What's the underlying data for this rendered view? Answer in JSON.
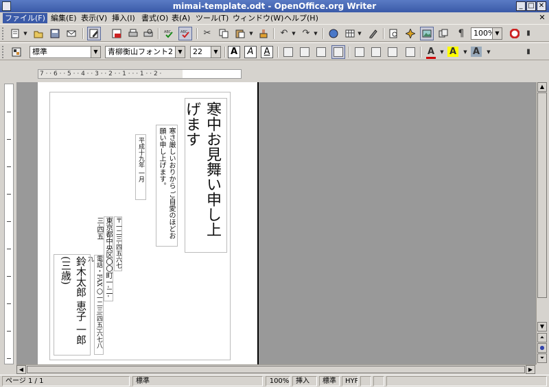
{
  "window": {
    "title": "mimai-template.odt - OpenOffice.org Writer",
    "buttons": {
      "minimize": "_",
      "maximize": "□",
      "close": "✕"
    }
  },
  "menu": [
    {
      "label": "ファイル(F)",
      "active": true
    },
    {
      "label": "編集(E)"
    },
    {
      "label": "表示(V)"
    },
    {
      "label": "挿入(I)"
    },
    {
      "label": "書式(O)"
    },
    {
      "label": "表(A)"
    },
    {
      "label": "ツール(T)"
    },
    {
      "label": "ウィンドウ(W)"
    },
    {
      "label": "ヘルプ(H)"
    }
  ],
  "toolbar": {
    "zoom": "100%",
    "paragraph_style": "標準",
    "font_name": "青柳衡山フォント2",
    "font_size": "22"
  },
  "ruler": {
    "marks": "7 · · 6 · · 5 · · 4 · · 3 · · 2 · · 1 · · · 1 · · 2 ·"
  },
  "document": {
    "greeting": "寒中お見舞い申し上げます",
    "body": "寒さ厳しいおりから ご自愛のほどお願い申し上げます。",
    "date": "平成十九年 一月",
    "postal": "〒一二三-四五六七",
    "address": "東京都中央区〇〇町一-二-三-四五",
    "phone": "電話・FAX 〇一二三(四五)六七八九",
    "names": "鈴木太郎 恵子 一郎(三歳)"
  },
  "status": {
    "page": "ページ 1 / 1",
    "style": "標準",
    "zoom": "100%",
    "insert_mode": "挿入",
    "selection_mode": "標準",
    "hyphenation": "HYP"
  }
}
